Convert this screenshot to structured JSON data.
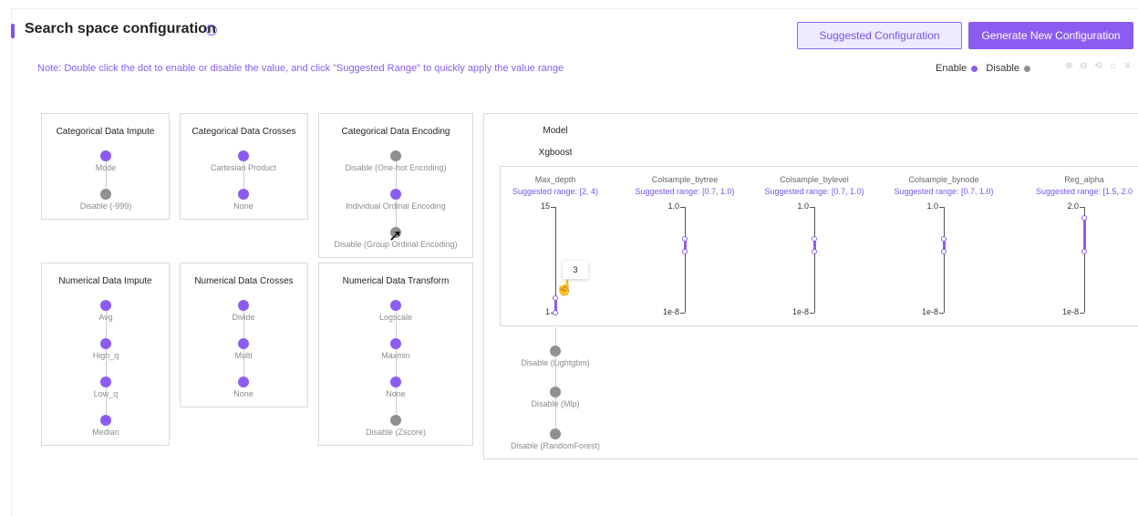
{
  "header": {
    "title": "Search space configuration",
    "help_icon": "question-circle-icon",
    "suggest_button": "Suggested Configuration",
    "generate_button": "Generate New Configuration"
  },
  "note": "Note: Double click the dot to enable or disable the value, and click \"Suggested Range\" to quickly apply the value range",
  "legend": {
    "enable": "Enable",
    "disable": "Disable",
    "enable_color": "#8c5cf2",
    "disable_color": "#909090"
  },
  "toolbar_icons": [
    "zoom-in-icon",
    "zoom-out-icon",
    "zoom-reset-icon",
    "home-icon",
    "menu-icon"
  ],
  "cards": {
    "cat_impute": {
      "title": "Categorical Data Impute",
      "nodes": [
        {
          "label": "Mode",
          "enabled": true
        },
        {
          "label": "Disable  (-999)",
          "enabled": false
        }
      ]
    },
    "cat_crosses": {
      "title": "Categorical Data Crosses",
      "nodes": [
        {
          "label": "Cartesian Product",
          "enabled": true
        },
        {
          "label": "None",
          "enabled": true
        }
      ]
    },
    "cat_encoding": {
      "title": "Categorical Data Encoding",
      "nodes": [
        {
          "label": "Disable  (One-hot Encoding)",
          "enabled": false
        },
        {
          "label": "Individual Ordinal Encoding",
          "enabled": true
        },
        {
          "label": "Disable  (Group Ordinal Encoding)",
          "enabled": false
        }
      ]
    },
    "num_impute": {
      "title": "Numerical Data Impute",
      "nodes": [
        {
          "label": "Avg",
          "enabled": true
        },
        {
          "label": "High_q",
          "enabled": true
        },
        {
          "label": "Low_q",
          "enabled": true
        },
        {
          "label": "Median",
          "enabled": true
        }
      ]
    },
    "num_crosses": {
      "title": "Numerical Data Crosses",
      "nodes": [
        {
          "label": "Divide",
          "enabled": true
        },
        {
          "label": "Multi",
          "enabled": true
        },
        {
          "label": "None",
          "enabled": true
        }
      ]
    },
    "num_transform": {
      "title": "Numerical Data Transform",
      "nodes": [
        {
          "label": "Logscale",
          "enabled": true
        },
        {
          "label": "Maxmin",
          "enabled": true
        },
        {
          "label": "None",
          "enabled": true
        },
        {
          "label": "Disable  (Zscore)",
          "enabled": false
        }
      ]
    }
  },
  "model": {
    "title": "Model",
    "selected": "Xgboost",
    "params": [
      {
        "name": "Max_depth",
        "suggested": "Suggested range: [2, 4)",
        "top": "15",
        "bottom": "1",
        "sel_top": 0.14,
        "sel_bottom": 0.0
      },
      {
        "name": "Colsample_bytree",
        "suggested": "Suggested range: [0.7, 1.0)",
        "top": "1.0",
        "bottom": "1e-8",
        "sel_top": 0.7,
        "sel_bottom": 0.58
      },
      {
        "name": "Colsample_bylevel",
        "suggested": "Suggested range: [0.7, 1.0)",
        "top": "1.0",
        "bottom": "1e-8",
        "sel_top": 0.7,
        "sel_bottom": 0.58
      },
      {
        "name": "Colsample_bynode",
        "suggested": "Suggested range: [0.7, 1.0)",
        "top": "1.0",
        "bottom": "1e-8",
        "sel_top": 0.7,
        "sel_bottom": 0.58
      },
      {
        "name": "Reg_alpha",
        "suggested": "Suggested range: [1.5, 2.0",
        "top": "2.0",
        "bottom": "1e-8",
        "sel_top": 0.9,
        "sel_bottom": 0.58
      }
    ],
    "tooltip_value": "3",
    "other_models": [
      {
        "label": "Disable (Lightgbm)",
        "enabled": false
      },
      {
        "label": "Disable (Mlp)",
        "enabled": false
      },
      {
        "label": "Disable (RandomForest)",
        "enabled": false
      }
    ]
  }
}
